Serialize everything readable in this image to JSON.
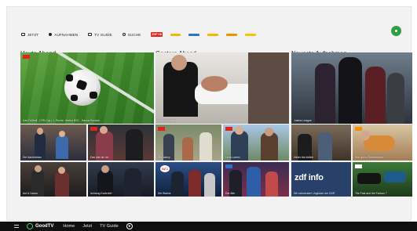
{
  "nav": {
    "items": [
      {
        "label": "JETZT",
        "icon": "tv-icon"
      },
      {
        "label": "AUFNAHMEN",
        "icon": "record-icon"
      },
      {
        "label": "TV GUIDE",
        "icon": "guide-icon"
      },
      {
        "label": "SUCHE",
        "icon": "search-icon"
      }
    ],
    "channels": [
      {
        "label": "ZDF HD",
        "color": "#e2231a"
      },
      {
        "label": "",
        "color": "#f7b500"
      },
      {
        "label": "",
        "color": "#2a73c9"
      },
      {
        "label": "",
        "color": "#f7b500"
      },
      {
        "label": "",
        "color": "#f39200"
      },
      {
        "label": "",
        "color": "#f7c600"
      }
    ]
  },
  "sections": [
    {
      "title": "Heute Abend"
    },
    {
      "title": "Gestern Abend"
    },
    {
      "title": "Neueste Aufnahmen"
    }
  ],
  "tiles": {
    "heute_main": "Das Fußball - DFB-Cup | 1. Runde, Hertha BSC - Hansa Rostock",
    "heute_1": "Die Nachrichten",
    "heute_2": "Das hier bin ich",
    "heute_3": "Auf & Davon",
    "heute_4": "Achtung Kontrolle!",
    "gestern_main": "Die Verfolgung",
    "gestern_1": "Die Nanny",
    "gestern_2": "Lena Lorenz",
    "gestern_3": "Die Wache",
    "gestern_4": "Der Alte",
    "neueste_main": "Justice League",
    "neueste_1": "Heiter bis tödlich",
    "neueste_2": "Wie gut ist Deutschland?",
    "neueste_3": "Die schwersten Unglücke der DDR",
    "neueste_4": "The Fast and the Furious 7"
  },
  "channel_badges": {
    "zdf_info": "zdf info",
    "sat1": "SAT.1"
  },
  "bottom": {
    "brand": "GoodTV",
    "links": [
      "Home",
      "Jetzt",
      "TV Guide"
    ]
  }
}
